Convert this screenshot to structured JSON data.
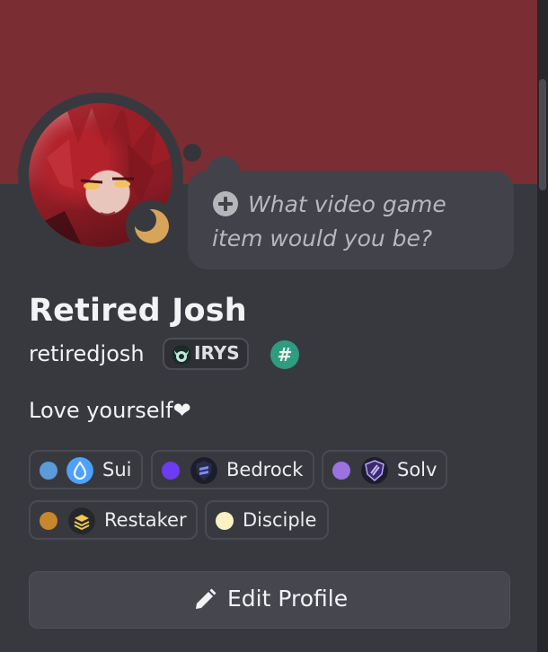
{
  "theme": {
    "banner_color": "#7a2d33",
    "card_color": "#38393f",
    "status": "idle"
  },
  "thought_bubble": {
    "icon": "plus-circle-icon",
    "placeholder": "What video game item would you be?"
  },
  "profile": {
    "display_name": "Retired Josh",
    "username": "retiredjosh",
    "server_tag": {
      "icon": "irys-icon",
      "label": "IRYS"
    },
    "badge": {
      "label": "#",
      "color": "#2f9c7f"
    },
    "bio": "Love yourself❤"
  },
  "roles": [
    {
      "label": "Sui",
      "dot_color": "#5b9bd9",
      "icon": "sui-droplet-icon"
    },
    {
      "label": "Bedrock",
      "dot_color": "#6c3cf0",
      "icon": "bedrock-shield-icon"
    },
    {
      "label": "Solv",
      "dot_color": "#9b72e0",
      "icon": "solv-shield-icon"
    },
    {
      "label": "Restaker",
      "dot_color": "#c7872a",
      "icon": "restaker-layers-icon"
    },
    {
      "label": "Disciple",
      "dot_color": "#fbf2c4"
    }
  ],
  "actions": {
    "edit_profile_label": "Edit Profile",
    "edit_icon": "pencil-icon"
  }
}
